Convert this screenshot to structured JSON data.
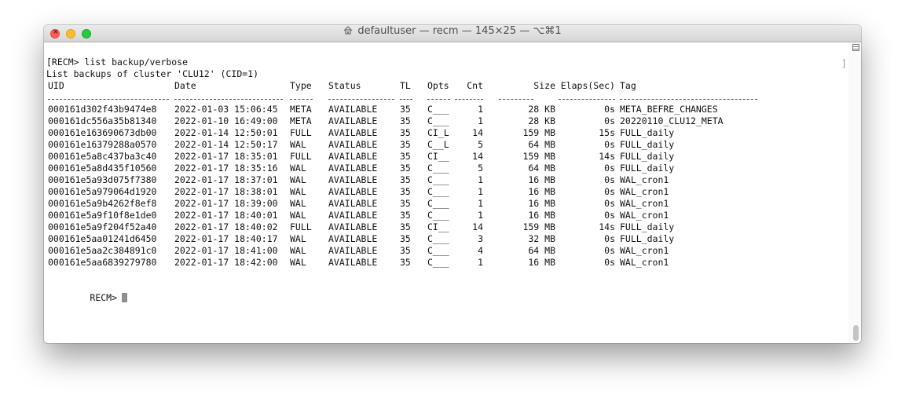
{
  "window": {
    "title": "defaultuser — recm — 145×25 — ⌥⌘1",
    "title_icon": "home-icon"
  },
  "terminal": {
    "command_line": "[RECM> list backup/verbose",
    "info_line": "List backups of cluster 'CLU12' (CID=1)",
    "headers": [
      "UID",
      "Date",
      "Type",
      "Status",
      "TL",
      "Opts",
      "Cnt",
      "Size",
      "Elaps(Sec)",
      "Tag"
    ],
    "rows": [
      [
        "000161d302f43b9474e8",
        "2022-01-03 15:06:45",
        "META",
        "AVAILABLE",
        "35",
        "C___",
        "1",
        "28 KB",
        "0s",
        "META_BEFRE_CHANGES"
      ],
      [
        "000161dc556a35b81340",
        "2022-01-10 16:49:00",
        "META",
        "AVAILABLE",
        "35",
        "C___",
        "1",
        "28 KB",
        "0s",
        "20220110_CLU12_META"
      ],
      [
        "000161e163690673db00",
        "2022-01-14 12:50:01",
        "FULL",
        "AVAILABLE",
        "35",
        "CI_L",
        "14",
        "159 MB",
        "15s",
        "FULL_daily"
      ],
      [
        "000161e16379288a0570",
        "2022-01-14 12:50:17",
        "WAL",
        "AVAILABLE",
        "35",
        "C__L",
        "5",
        "64 MB",
        "0s",
        "FULL_daily"
      ],
      [
        "000161e5a8c437ba3c40",
        "2022-01-17 18:35:01",
        "FULL",
        "AVAILABLE",
        "35",
        "CI__",
        "14",
        "159 MB",
        "14s",
        "FULL_daily"
      ],
      [
        "000161e5a8d435f10560",
        "2022-01-17 18:35:16",
        "WAL",
        "AVAILABLE",
        "35",
        "C___",
        "5",
        "64 MB",
        "0s",
        "FULL_daily"
      ],
      [
        "000161e5a93d075f7380",
        "2022-01-17 18:37:01",
        "WAL",
        "AVAILABLE",
        "35",
        "C___",
        "1",
        "16 MB",
        "0s",
        "WAL_cron1"
      ],
      [
        "000161e5a979064d1920",
        "2022-01-17 18:38:01",
        "WAL",
        "AVAILABLE",
        "35",
        "C___",
        "1",
        "16 MB",
        "0s",
        "WAL_cron1"
      ],
      [
        "000161e5a9b4262f8ef8",
        "2022-01-17 18:39:00",
        "WAL",
        "AVAILABLE",
        "35",
        "C___",
        "1",
        "16 MB",
        "0s",
        "WAL_cron1"
      ],
      [
        "000161e5a9f10f8e1de0",
        "2022-01-17 18:40:01",
        "WAL",
        "AVAILABLE",
        "35",
        "C___",
        "1",
        "16 MB",
        "0s",
        "WAL_cron1"
      ],
      [
        "000161e5a9f204f52a40",
        "2022-01-17 18:40:02",
        "FULL",
        "AVAILABLE",
        "35",
        "CI__",
        "14",
        "159 MB",
        "14s",
        "FULL_daily"
      ],
      [
        "000161e5aa01241d6450",
        "2022-01-17 18:40:17",
        "WAL",
        "AVAILABLE",
        "35",
        "C___",
        "3",
        "32 MB",
        "0s",
        "FULL_daily"
      ],
      [
        "000161e5aa2c384891c0",
        "2022-01-17 18:41:00",
        "WAL",
        "AVAILABLE",
        "35",
        "C___",
        "4",
        "64 MB",
        "0s",
        "WAL_cron1"
      ],
      [
        "000161e5aa6839279780",
        "2022-01-17 18:42:00",
        "WAL",
        "AVAILABLE",
        "35",
        "C___",
        "1",
        "16 MB",
        "0s",
        "WAL_cron1"
      ]
    ],
    "prompt": "RECM>"
  }
}
